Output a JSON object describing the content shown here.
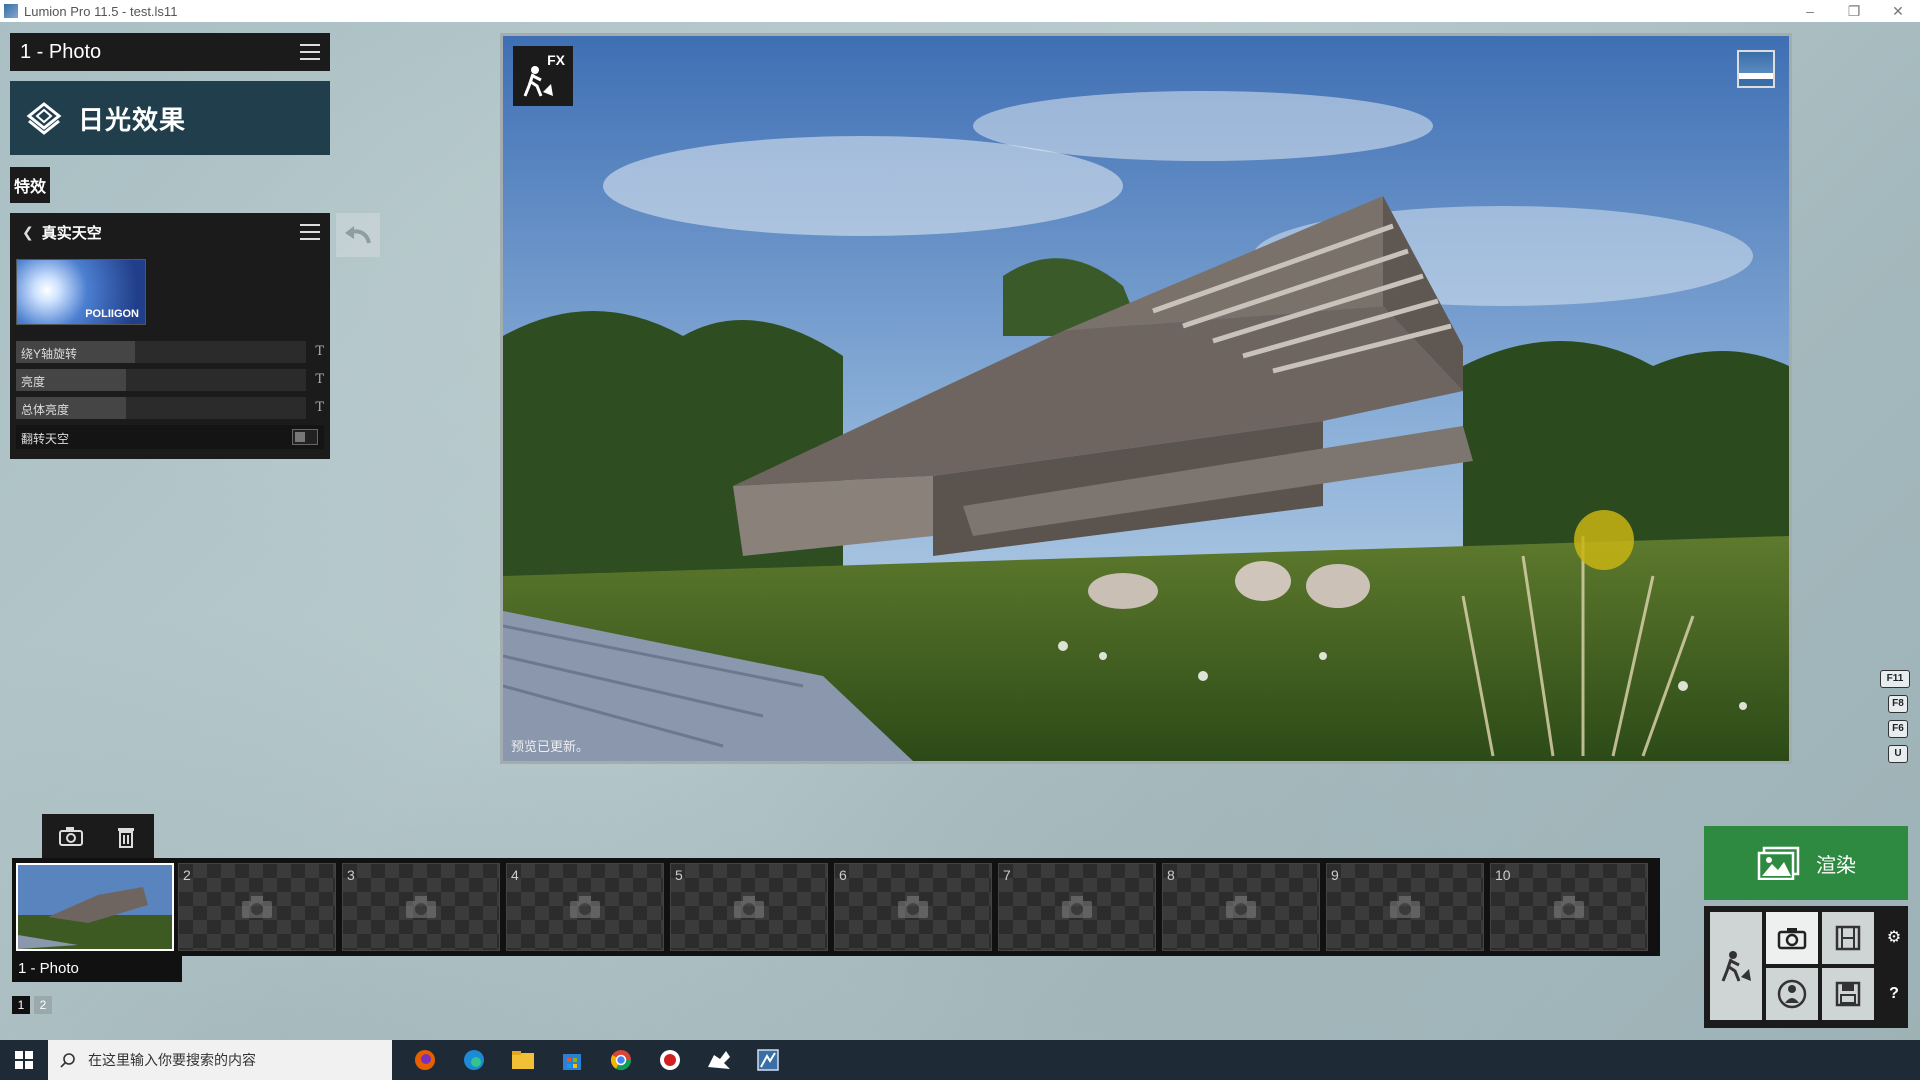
{
  "window": {
    "title": "Lumion Pro 11.5 - test.ls11",
    "minimize": "–",
    "restore": "❐",
    "close": "✕"
  },
  "left_panel": {
    "photo_title": "1 - Photo",
    "effect_title": "日光效果",
    "tab_label": "特效",
    "sky_panel": {
      "title": "真实天空",
      "thumbnail_watermark": "POLIIGON",
      "sliders": [
        {
          "label": "绕Y轴旋转",
          "value": 0.41
        },
        {
          "label": "亮度",
          "value": 0.38
        },
        {
          "label": "总体亮度",
          "value": 0.38
        }
      ],
      "toggle_label": "翻转天空",
      "t_glyph": "T"
    }
  },
  "viewport": {
    "fx_label": "FX",
    "status": "预览已更新。"
  },
  "hotkeys": [
    "F11",
    "F8",
    "F6",
    "U"
  ],
  "filmstrip": {
    "active_label": "1 - Photo",
    "slots": [
      "2",
      "3",
      "4",
      "5",
      "6",
      "7",
      "8",
      "9",
      "10"
    ],
    "pages": [
      "1",
      "2"
    ]
  },
  "render_button": {
    "label": "渲染"
  },
  "taskbar": {
    "search_placeholder": "在这里输入你要搜索的内容"
  },
  "colors": {
    "panel": "#1b1b1b",
    "banner": "#213e4d",
    "render": "#2f8a41",
    "taskbar": "#1e2a36"
  }
}
